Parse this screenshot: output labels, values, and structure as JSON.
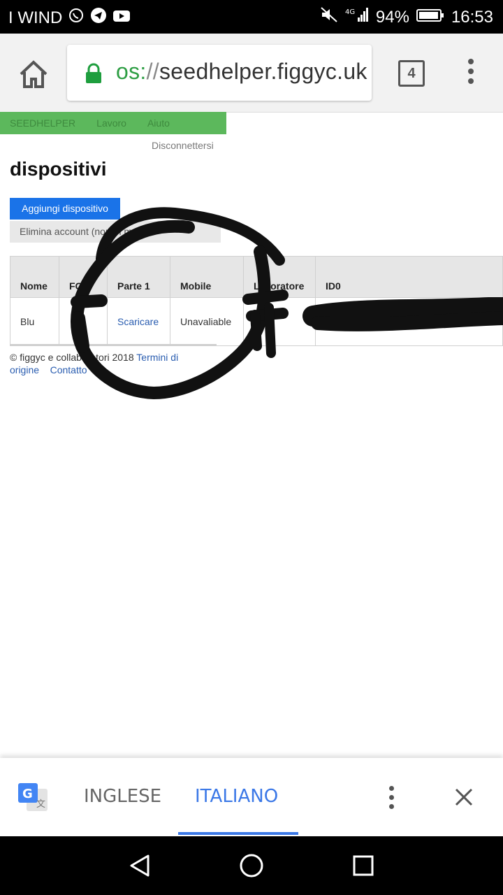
{
  "status_bar": {
    "carrier": "I WIND",
    "network": "4G",
    "battery": "94%",
    "time": "16:53",
    "icons": [
      "whatsapp-icon",
      "telegram-icon",
      "youtube-icon",
      "mute-icon",
      "signal-icon",
      "battery-icon"
    ]
  },
  "browser": {
    "url_scheme": "os:",
    "url_sep": "//",
    "url_host": "seedhelper.figgyc.uk",
    "tab_count": "4"
  },
  "nav": {
    "items": [
      "SEEDHELPER",
      "Lavoro",
      "Aiuto"
    ],
    "logout": "Disconnettersi"
  },
  "page": {
    "title": "dispositivi",
    "add_button": "Aggiungi dispositivo",
    "delete_button": "Elimina account (non in modo"
  },
  "table": {
    "headers": [
      "Nome",
      "FC",
      "Parte 1",
      "Mobile",
      "Lavoratore",
      "ID0"
    ],
    "rows": [
      [
        "Blu",
        "",
        "Scaricare",
        "Unavaliable",
        "",
        ""
      ]
    ]
  },
  "footer": {
    "copyright": "© figgyc e collaboratori 2018",
    "terms": "Termini di origine",
    "contact": "Contatto"
  },
  "translate_bar": {
    "source_lang": "INGLESE",
    "target_lang": "ITALIANO"
  },
  "colors": {
    "navbar_green": "#5cb85c",
    "primary_blue": "#1a73e8",
    "link_blue": "#2a5db0",
    "translate_accent": "#3b78e7"
  }
}
